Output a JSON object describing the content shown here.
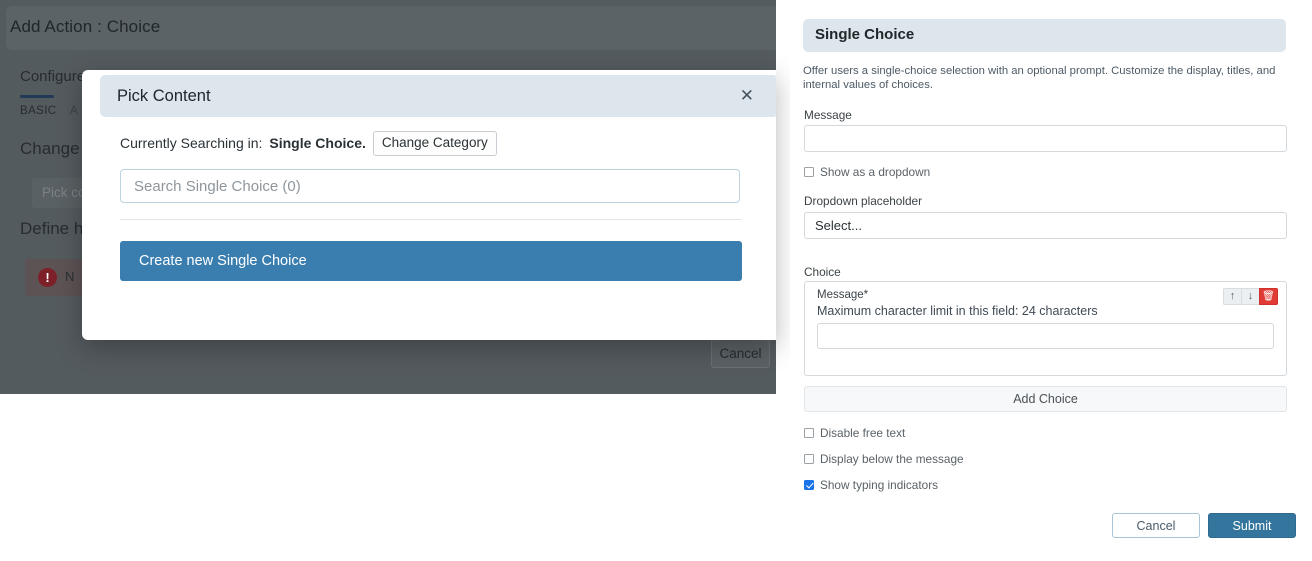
{
  "background_app": {
    "header_title": "Add Action : Choice",
    "configure_label": "Configure",
    "tabs": [
      {
        "label": "BASIC",
        "active": true
      },
      {
        "label": "A",
        "active": false
      }
    ],
    "section_change": "Change t",
    "pick_content_placeholder": "Pick co",
    "section_define": "Define h",
    "alert_text": "N",
    "alert_icon": "exclamation-icon",
    "cancel_label": "Cancel"
  },
  "modal": {
    "title": "Pick Content",
    "close_icon": "close-icon",
    "searching_prefix": "Currently Searching in:",
    "searching_category": "Single Choice.",
    "change_category_label": "Change Category",
    "search_placeholder": "Search Single Choice (0)",
    "search_value": "",
    "create_new_label": "Create new Single Choice"
  },
  "right_panel": {
    "title": "Single Choice",
    "description": "Offer users a single-choice selection with an optional prompt. Customize the display, titles, and internal values of choices.",
    "message_label": "Message",
    "message_value": "",
    "show_as_dropdown_label": "Show as a dropdown",
    "show_as_dropdown_checked": false,
    "dropdown_placeholder_label": "Dropdown placeholder",
    "dropdown_placeholder_value": "Select...",
    "choice_label": "Choice",
    "choice_item": {
      "message_label": "Message*",
      "hint": "Maximum character limit in this field: 24 characters",
      "value": "",
      "move_up_icon": "arrow-up-icon",
      "move_down_icon": "arrow-down-icon",
      "delete_icon": "trash-icon"
    },
    "add_choice_label": "Add Choice",
    "checkboxes": [
      {
        "label": "Disable free text",
        "checked": false
      },
      {
        "label": "Display below the message",
        "checked": false
      },
      {
        "label": "Show typing indicators",
        "checked": true
      }
    ],
    "cancel_label": "Cancel",
    "submit_label": "Submit"
  },
  "colors": {
    "accent_blue": "#3a7eb0",
    "submit_blue": "#33759d",
    "header_bg": "#dde6ec",
    "overlay_dark": "#545b5f",
    "danger_red": "#e03b35",
    "checkbox_blue": "#1a73e8"
  }
}
